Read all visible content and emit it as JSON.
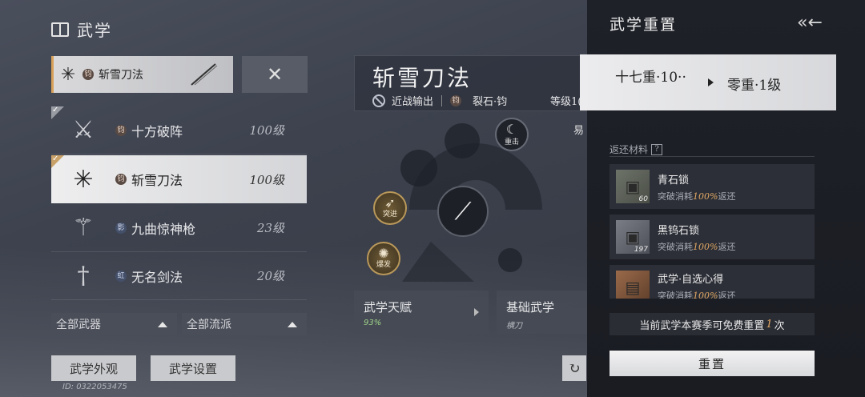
{
  "header": {
    "title": "武学",
    "icon": "book-icon"
  },
  "selected_skill": {
    "badge": "钧",
    "name": "斩雪刀法"
  },
  "skill_list": [
    {
      "badge": "钧",
      "badge_style": "dark",
      "name": "十方破阵",
      "level": "100级",
      "checked": true,
      "active": false,
      "icon": "halberd-icon"
    },
    {
      "badge": "钧",
      "badge_style": "dark",
      "name": "斩雪刀法",
      "level": "100级",
      "checked": true,
      "active": true,
      "icon": "snow-blade-icon"
    },
    {
      "badge": "影",
      "badge_style": "blue",
      "name": "九曲惊神枪",
      "level": "23级",
      "checked": false,
      "active": false,
      "icon": "spear-icon"
    },
    {
      "badge": "虹",
      "badge_style": "blue",
      "name": "无名剑法",
      "level": "20级",
      "checked": false,
      "active": false,
      "icon": "sword-icon"
    }
  ],
  "filters": {
    "weapons": "全部武器",
    "schools": "全部流派"
  },
  "bottom_buttons": {
    "appearance": "武学外观",
    "settings": "武学设置"
  },
  "uid": "ID: 0322053475",
  "skill_detail": {
    "title": "斩雪刀法",
    "tag1": "近战输出",
    "tag2_badge": "钧",
    "tag2": "裂石·钧",
    "grade": "等级1(",
    "yi": "易",
    "heavy": "重击",
    "breakthrough": "突进",
    "burst": "爆发"
  },
  "tabs": [
    {
      "title": "武学天赋",
      "sub": "93%"
    },
    {
      "title": "基础武学",
      "sub": "横刀"
    }
  ],
  "reset_panel": {
    "title": "武学重置",
    "from_level": "十七重·10··",
    "to_level": "零重·1级",
    "materials_label": "返还材料",
    "materials": [
      {
        "name": "青石锁",
        "count": "60",
        "desc_prefix": "突破消耗",
        "pct": "100%",
        "desc_suffix": "返还"
      },
      {
        "name": "黑钨石锁",
        "count": "197",
        "desc_prefix": "突破消耗",
        "pct": "100%",
        "desc_suffix": "返还"
      },
      {
        "name": "武学·自选心得",
        "count": "",
        "desc_prefix": "突破消耗",
        "pct": "100%",
        "desc_suffix": "返还"
      }
    ],
    "free_note_prefix": "当前武学本赛季可免费重置",
    "free_note_count": "1",
    "free_note_suffix": "次",
    "reset_button": "重置"
  }
}
